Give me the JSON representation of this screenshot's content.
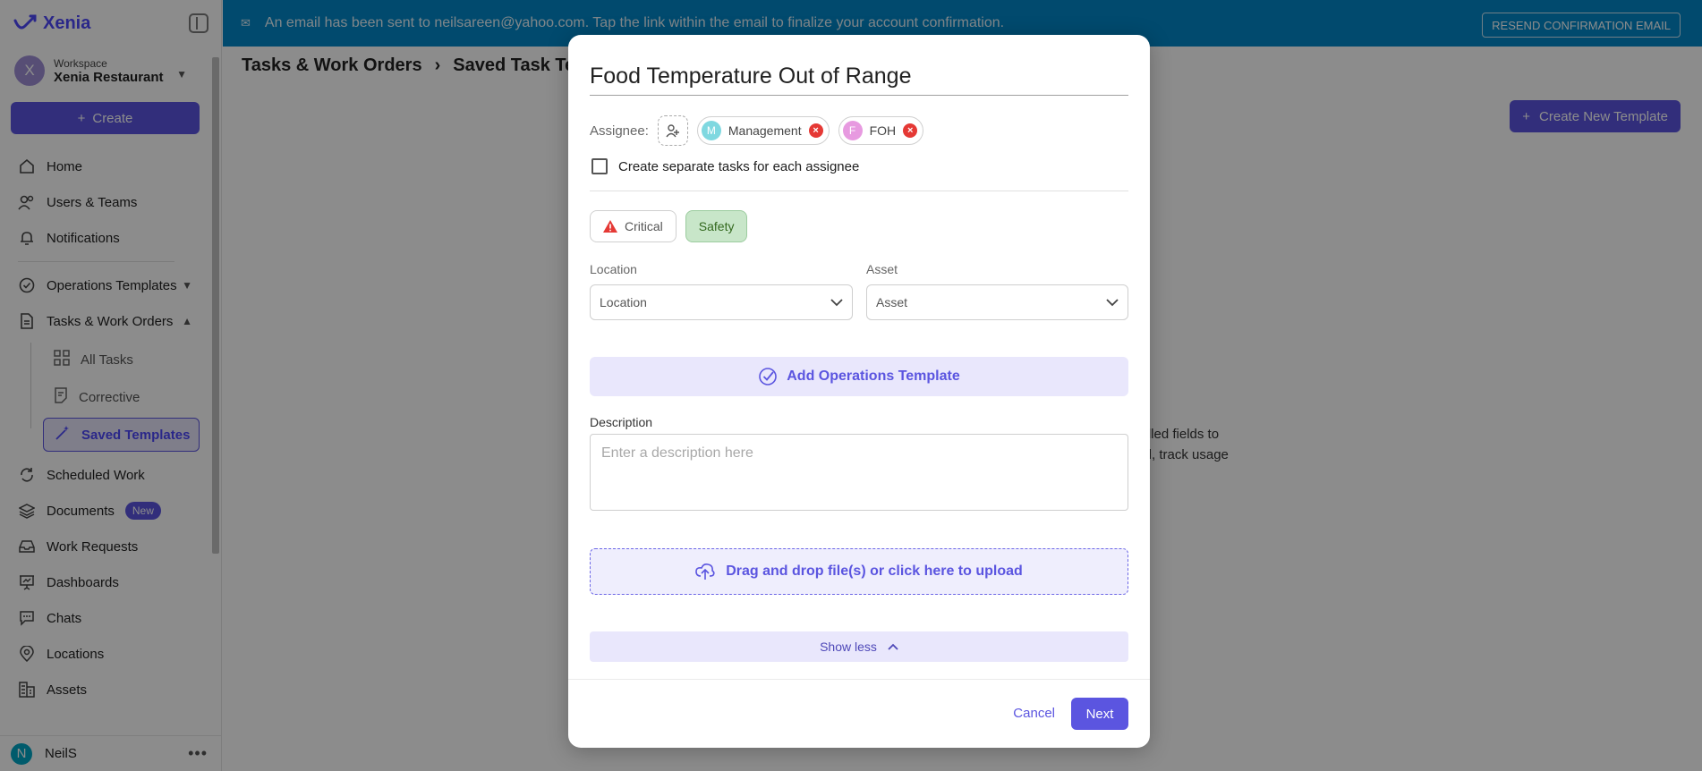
{
  "app": {
    "logo_text": "Xenia"
  },
  "workspace": {
    "label": "Workspace",
    "name": "Xenia Restaurant",
    "avatar_letter": "X"
  },
  "sidebar": {
    "create_label": "Create",
    "items": [
      {
        "label": "Home",
        "icon": "home-icon"
      },
      {
        "label": "Users & Teams",
        "icon": "users-icon"
      },
      {
        "label": "Notifications",
        "icon": "bell-icon"
      },
      {
        "label": "Operations Templates",
        "icon": "check-circle-icon"
      },
      {
        "label": "Tasks & Work Orders",
        "icon": "document-icon"
      },
      {
        "label": "Scheduled Work",
        "icon": "recurring-icon"
      },
      {
        "label": "Documents",
        "icon": "layers-icon",
        "badge": "New"
      },
      {
        "label": "Work Requests",
        "icon": "inbox-icon"
      },
      {
        "label": "Dashboards",
        "icon": "presentation-icon"
      },
      {
        "label": "Chats",
        "icon": "chat-icon"
      },
      {
        "label": "Locations",
        "icon": "pin-icon"
      },
      {
        "label": "Assets",
        "icon": "assets-icon"
      }
    ],
    "sub_items": [
      {
        "label": "All Tasks",
        "icon": "grid-icon"
      },
      {
        "label": "Corrective",
        "icon": "list-icon"
      },
      {
        "label": "Saved Templates",
        "icon": "wand-icon"
      }
    ],
    "user": {
      "name": "NeilS",
      "avatar_letter": "N"
    }
  },
  "banner": {
    "message": "An email has been sent to neilsareen@yahoo.com. Tap the link within the email to finalize your account confirmation.",
    "resend_label": "RESEND CONFIRMATION EMAIL"
  },
  "header": {
    "breadcrumb_root": "Tasks & Work Orders",
    "breadcrumb_current": "Saved Task Te",
    "create_new_label": "Create New Template"
  },
  "background": {
    "line1": "e-filled fields to",
    "line2": "hed, track usage"
  },
  "modal": {
    "title": "Food Temperature Out of Range",
    "assignee_label": "Assignee:",
    "assignees": [
      {
        "name": "Management",
        "letter": "M",
        "color": "#7fd8e0"
      },
      {
        "name": "FOH",
        "letter": "F",
        "color": "#e79ae0"
      }
    ],
    "separate_tasks_label": "Create separate tasks for each assignee",
    "tags": {
      "critical": "Critical",
      "safety": "Safety"
    },
    "location": {
      "label": "Location",
      "placeholder": "Location"
    },
    "asset": {
      "label": "Asset",
      "placeholder": "Asset"
    },
    "add_ops_label": "Add Operations Template",
    "description": {
      "label": "Description",
      "placeholder": "Enter a description here"
    },
    "upload_label": "Drag and drop file(s) or click here to upload",
    "show_less_label": "Show less",
    "cancel_label": "Cancel",
    "next_label": "Next"
  },
  "colors": {
    "accent": "#5b55e0",
    "banner": "#0288c8",
    "critical": "#e53935",
    "safety_bg": "#c8e6c9"
  }
}
